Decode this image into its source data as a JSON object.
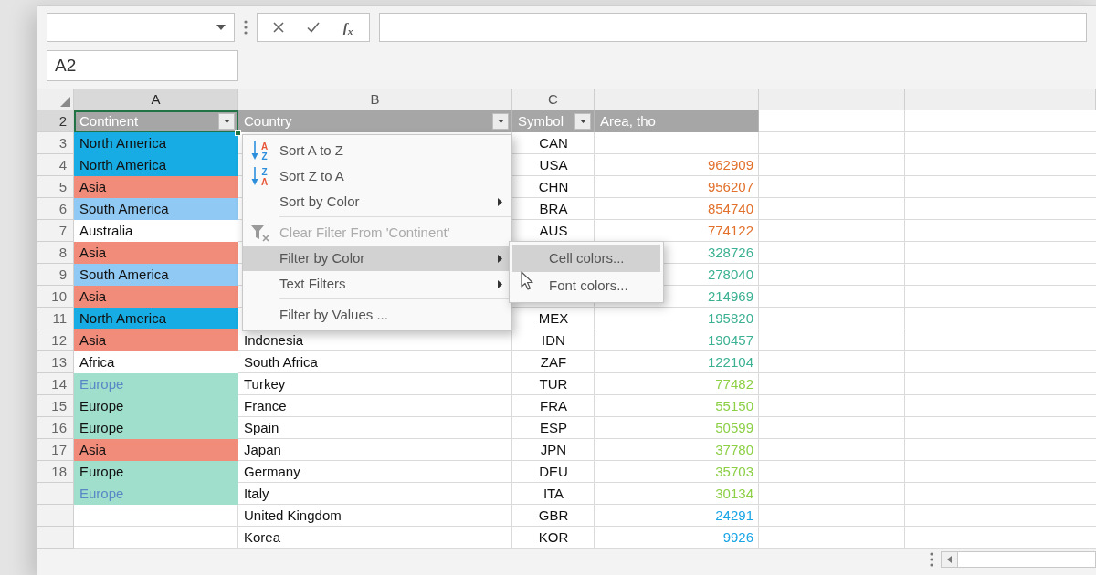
{
  "toolbar": {
    "formula_buttons": [
      {
        "kind": "cancel"
      },
      {
        "kind": "enter"
      },
      {
        "kind": "function",
        "label": "f$_{x}$"
      }
    ]
  },
  "name_box": {
    "value": "A2"
  },
  "column_headings": [
    {
      "label": "A",
      "selected": true
    },
    {
      "label": "B",
      "selected": false
    },
    {
      "label": "C",
      "selected": false
    }
  ],
  "header_row": {
    "number": "2",
    "selected": true,
    "cells": [
      {
        "text": "Continent",
        "filter": true
      },
      {
        "text": "Country",
        "filter": true
      },
      {
        "text": "Symbol",
        "filter": true
      },
      {
        "text": "Area, tho",
        "filter": false
      }
    ]
  },
  "rows": [
    {
      "number": "3",
      "selected": false,
      "continent": {
        "text": "North America",
        "color": "#17ace3"
      },
      "symbol": {
        "text": "CAN"
      }
    },
    {
      "number": "4",
      "selected": false,
      "continent": {
        "text": "North America",
        "color": "#17ace3"
      },
      "symbol": {
        "text": "USA"
      },
      "area": {
        "text": "962909",
        "color": "#e2702b"
      }
    },
    {
      "number": "5",
      "selected": false,
      "continent": {
        "text": "Asia",
        "color": "#f28c7a"
      },
      "symbol": {
        "text": "CHN"
      },
      "area": {
        "text": "956207",
        "color": "#e2702b"
      }
    },
    {
      "number": "6",
      "selected": false,
      "continent": {
        "text": "South America",
        "color": "#90c9f4"
      },
      "symbol": {
        "text": "BRA"
      },
      "area": {
        "text": "854740",
        "color": "#e2702b"
      }
    },
    {
      "number": "7",
      "selected": false,
      "continent": {
        "text": "Australia",
        "color": "#ffffff"
      },
      "symbol": {
        "text": "AUS"
      },
      "area": {
        "text": "774122",
        "color": "#e2702b"
      }
    },
    {
      "number": "8",
      "selected": false,
      "continent": {
        "text": "Asia",
        "color": "#f28c7a"
      },
      "area": {
        "text": "328726",
        "color": "#3cb193"
      }
    },
    {
      "number": "9",
      "selected": false,
      "continent": {
        "text": "South America",
        "color": "#90c9f4"
      },
      "area": {
        "text": "278040",
        "color": "#3cb193"
      }
    },
    {
      "number": "10",
      "selected": false,
      "continent": {
        "text": "Asia",
        "color": "#f28c7a"
      },
      "area": {
        "text": "214969",
        "color": "#3cb193"
      }
    },
    {
      "number": "11",
      "selected": false,
      "continent": {
        "text": "North America",
        "color": "#17ace3"
      },
      "symbol": {
        "text": "MEX"
      },
      "area": {
        "text": "195820",
        "color": "#3cb193"
      }
    },
    {
      "number": "12",
      "selected": false,
      "continent": {
        "text": "Asia",
        "color": "#f28c7a"
      },
      "country": {
        "text": "Indonesia"
      },
      "symbol": {
        "text": "IDN"
      },
      "area": {
        "text": "190457",
        "color": "#3cb193"
      }
    },
    {
      "number": "13",
      "selected": false,
      "continent": {
        "text": "Africa",
        "color": "#ffffff"
      },
      "country": {
        "text": "South Africa"
      },
      "symbol": {
        "text": "ZAF"
      },
      "area": {
        "text": "122104",
        "color": "#3cb193"
      }
    },
    {
      "number": "14",
      "selected": false,
      "continent": {
        "text": "Europe",
        "color": "#9fdfcb",
        "font": {
          "color": "#5a88c6"
        }
      },
      "country": {
        "text": "Turkey"
      },
      "symbol": {
        "text": "TUR"
      },
      "area": {
        "text": "77482",
        "color": "#8dd046"
      }
    },
    {
      "number": "15",
      "selected": false,
      "continent": {
        "text": "Europe",
        "color": "#9fdfcb"
      },
      "country": {
        "text": "France"
      },
      "symbol": {
        "text": "FRA"
      },
      "area": {
        "text": "55150",
        "color": "#8dd046"
      }
    },
    {
      "number": "16",
      "selected": false,
      "continent": {
        "text": "Europe",
        "color": "#9fdfcb"
      },
      "country": {
        "text": "Spain"
      },
      "symbol": {
        "text": "ESP"
      },
      "area": {
        "text": "50599",
        "color": "#8dd046"
      }
    },
    {
      "number": "17",
      "selected": false,
      "continent": {
        "text": "Asia",
        "color": "#f28c7a"
      },
      "country": {
        "text": "Japan"
      },
      "symbol": {
        "text": "JPN"
      },
      "area": {
        "text": "37780",
        "color": "#8dd046"
      }
    },
    {
      "number": "18",
      "selected": false,
      "continent": {
        "text": "Europe",
        "color": "#9fdfcb"
      },
      "country": {
        "text": "Germany"
      },
      "symbol": {
        "text": "DEU"
      },
      "area": {
        "text": "35703",
        "color": "#8dd046"
      }
    },
    {
      "selected": false,
      "continent": {
        "text": "Europe",
        "color": "#9fdfcb",
        "font": {
          "color": "#5a88c6"
        }
      },
      "country": {
        "text": "Italy"
      },
      "symbol": {
        "text": "ITA"
      },
      "area": {
        "text": "30134",
        "color": "#8dd046"
      }
    },
    {
      "selected": false,
      "country": {
        "text": "United Kingdom"
      },
      "symbol": {
        "text": "GBR"
      },
      "area": {
        "text": "24291",
        "color": "#1aa6e6"
      }
    },
    {
      "selected": false,
      "country": {
        "text": "Korea"
      },
      "symbol": {
        "text": "KOR"
      },
      "area": {
        "text": "9926",
        "color": "#1aa6e6"
      }
    }
  ],
  "filter_menu": {
    "items": [
      {
        "kind": "ascending",
        "label": "Sort A to Z",
        "icon_letters": [
          "A",
          "Z"
        ],
        "selected": false,
        "disabled": false,
        "submenu": false
      },
      {
        "kind": "descending",
        "label": "Sort Z to A",
        "icon_letters": [
          "Z",
          "A"
        ],
        "selected": false,
        "disabled": false,
        "submenu": false
      },
      {
        "kind": "plain",
        "label": "Sort by Color",
        "selected": false,
        "disabled": false,
        "submenu": true
      },
      {
        "kind": "separator"
      },
      {
        "kind": "unfilter",
        "label": "Clear Filter From 'Continent'",
        "selected": false,
        "disabled": true,
        "submenu": false
      },
      {
        "kind": "plain",
        "label": "Filter by Color",
        "selected": true,
        "disabled": false,
        "submenu": true
      },
      {
        "kind": "plain",
        "label": "Text Filters",
        "selected": false,
        "disabled": false,
        "submenu": true
      },
      {
        "kind": "separator"
      },
      {
        "kind": "plain",
        "label": "Filter by Values ...",
        "selected": false,
        "disabled": false,
        "submenu": false
      }
    ]
  },
  "color_submenu": {
    "items": [
      {
        "label": "Cell colors...",
        "selected": true
      },
      {
        "label": "Font colors...",
        "selected": false
      }
    ]
  }
}
